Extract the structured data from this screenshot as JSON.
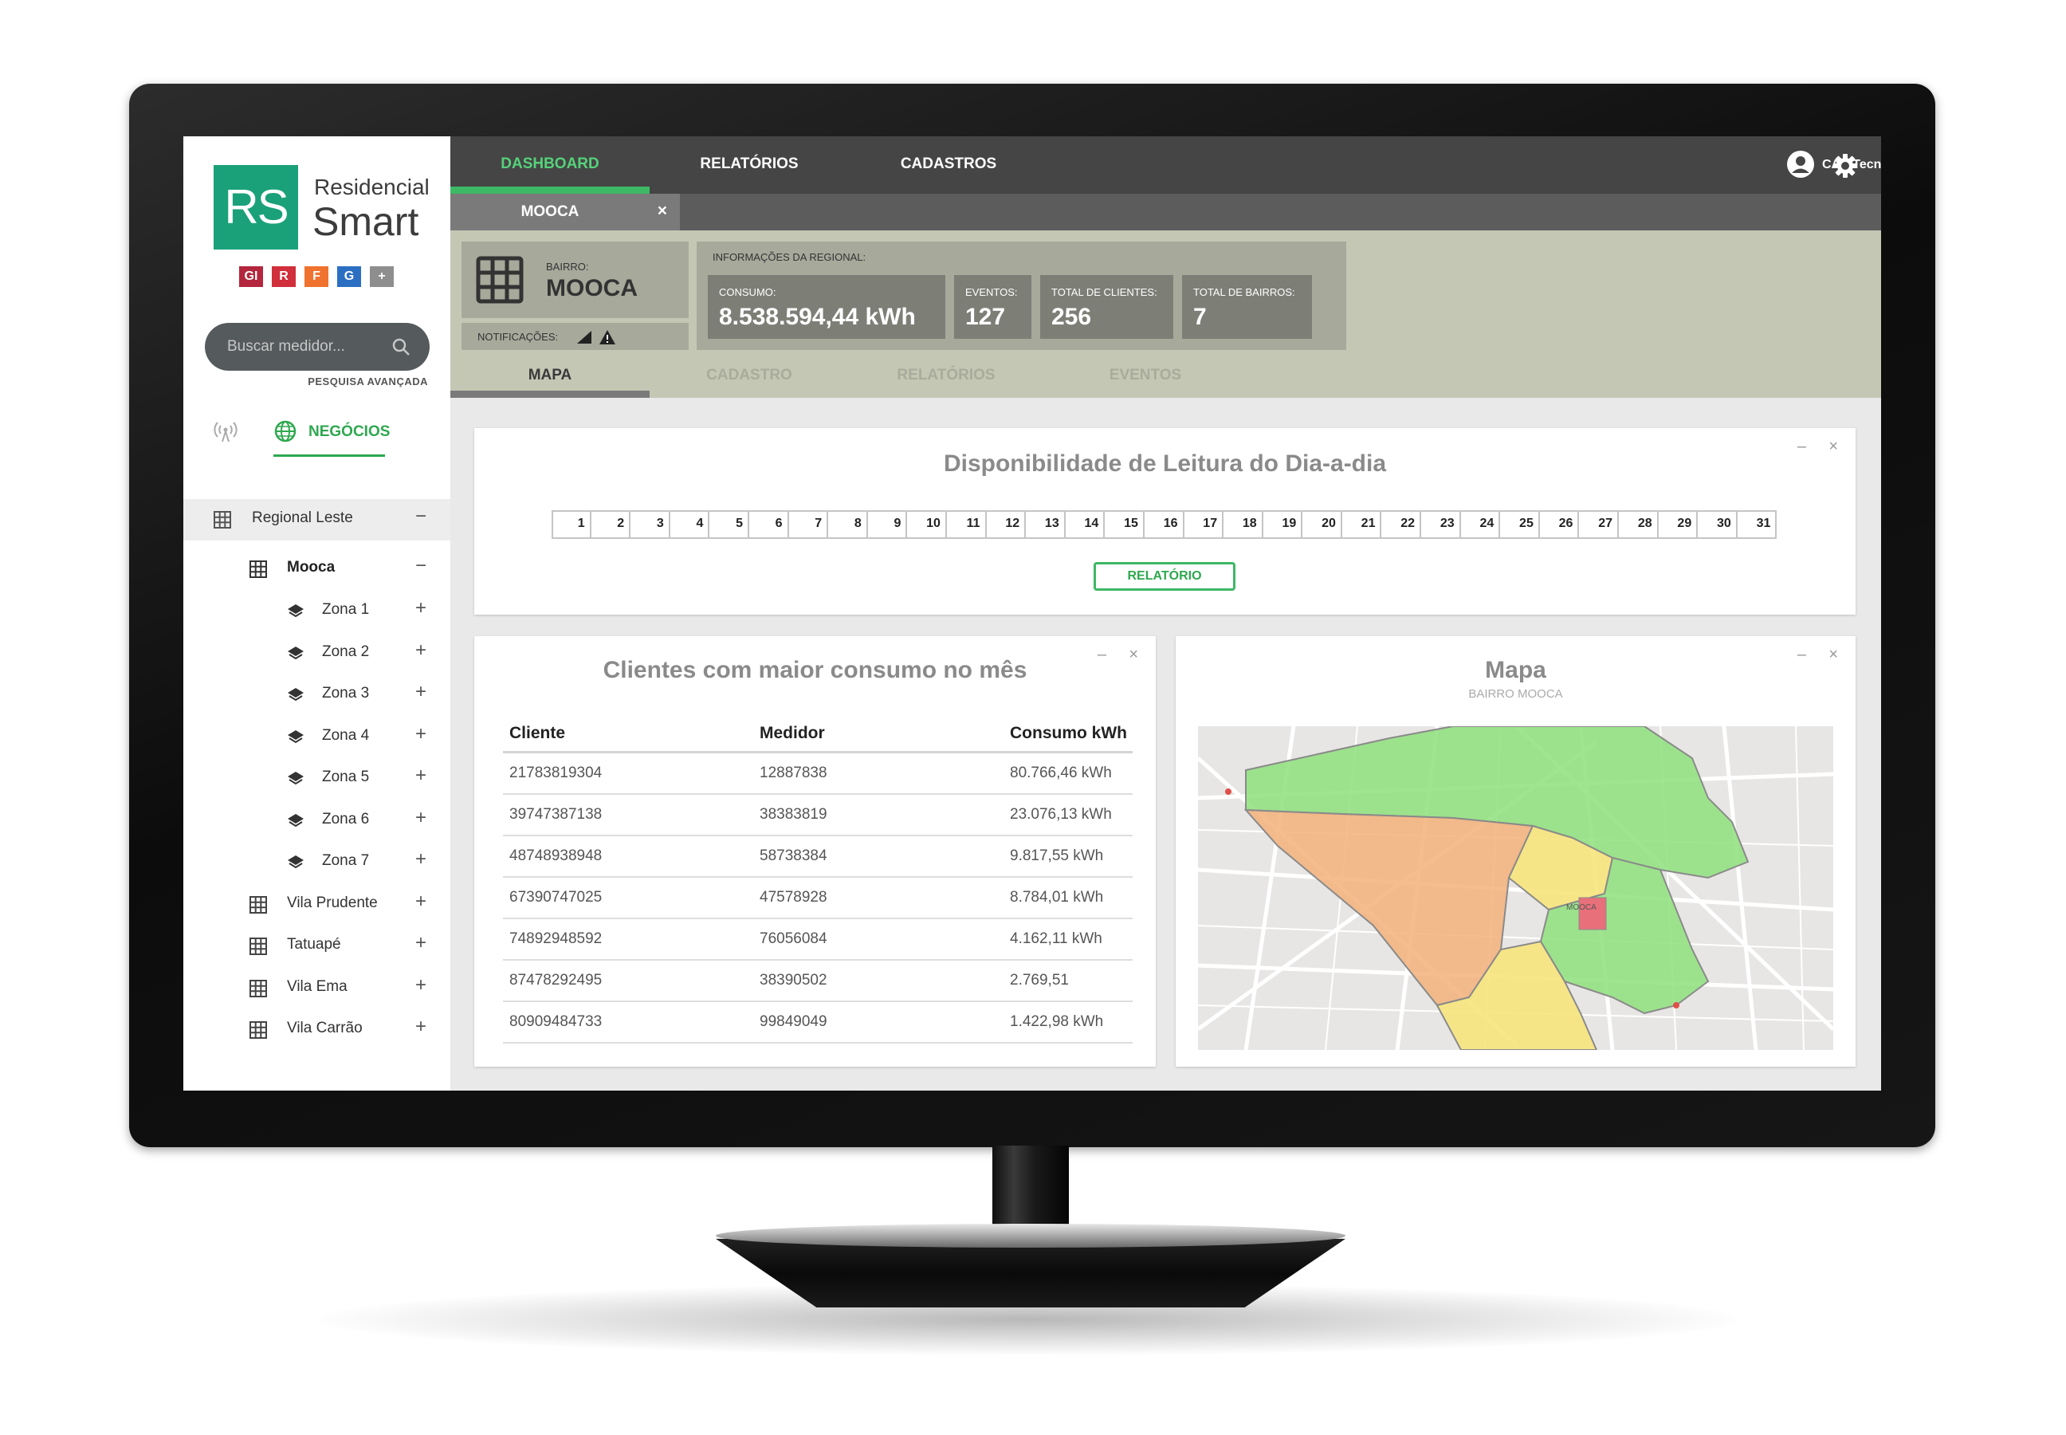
{
  "brand": {
    "logo_mark": "RS",
    "line1": "Residencial",
    "line2": "Smart"
  },
  "modules": [
    {
      "label": "GI",
      "color": "#b3263d"
    },
    {
      "label": "R",
      "color": "#d12f3b"
    },
    {
      "label": "F",
      "color": "#f0722f"
    },
    {
      "label": "G",
      "color": "#2b6fc2"
    },
    {
      "label": "+",
      "color": "#8e8e8e"
    }
  ],
  "search": {
    "placeholder": "Buscar medidor...",
    "advanced": "PESQUISA AVANÇADA"
  },
  "mode_tab": {
    "label": "NEGÓCIOS"
  },
  "tree": {
    "regional": {
      "label": "Regional Leste",
      "toggle": "−"
    },
    "bairro": {
      "label": "Mooca",
      "toggle": "−"
    },
    "zonas": [
      {
        "label": "Zona 1",
        "toggle": "+"
      },
      {
        "label": "Zona 2",
        "toggle": "+"
      },
      {
        "label": "Zona 3",
        "toggle": "+"
      },
      {
        "label": "Zona 4",
        "toggle": "+"
      },
      {
        "label": "Zona 5",
        "toggle": "+"
      },
      {
        "label": "Zona 6",
        "toggle": "+"
      },
      {
        "label": "Zona 7",
        "toggle": "+"
      }
    ],
    "others": [
      {
        "label": "Vila Prudente",
        "toggle": "+"
      },
      {
        "label": "Tatuapé",
        "toggle": "+"
      },
      {
        "label": "Vila Ema",
        "toggle": "+"
      },
      {
        "label": "Vila Carrão",
        "toggle": "+"
      }
    ]
  },
  "topnav": [
    {
      "label": "DASHBOARD",
      "active": true
    },
    {
      "label": "RELATÓRIOS",
      "active": false
    },
    {
      "label": "CADASTROS",
      "active": false
    }
  ],
  "user": {
    "name": "CAS Tecnologia"
  },
  "open_tab": {
    "label": "MOOCA",
    "close": "×"
  },
  "bairro": {
    "caption": "BAIRRO:",
    "value": "MOOCA"
  },
  "notifications": {
    "label": "NOTIFICAÇÕES:"
  },
  "regional_info": {
    "caption": "INFORMAÇÕES DA REGIONAL:",
    "cards": [
      {
        "key": "CONSUMO:",
        "value": "8.538.594,44 kWh"
      },
      {
        "key": "EVENTOS:",
        "value": "127"
      },
      {
        "key": "TOTAL DE CLIENTES:",
        "value": "256"
      },
      {
        "key": "TOTAL DE BAIRROS:",
        "value": "7"
      }
    ]
  },
  "subnav": [
    {
      "label": "MAPA",
      "active": true
    },
    {
      "label": "CADASTRO",
      "active": false
    },
    {
      "label": "RELATÓRIOS",
      "active": false
    },
    {
      "label": "EVENTOS",
      "active": false
    }
  ],
  "panel_controls": {
    "minimize": "–",
    "close": "×"
  },
  "availability": {
    "title": "Disponibilidade de Leitura do Dia-a-dia",
    "days": [
      "1",
      "2",
      "3",
      "4",
      "5",
      "6",
      "7",
      "8",
      "9",
      "10",
      "11",
      "12",
      "13",
      "14",
      "15",
      "16",
      "17",
      "18",
      "19",
      "20",
      "21",
      "22",
      "23",
      "24",
      "25",
      "26",
      "27",
      "28",
      "29",
      "30",
      "31"
    ],
    "button": "RELATÓRIO"
  },
  "top_clients": {
    "title": "Clientes com maior consumo no mês",
    "columns": [
      "Cliente",
      "Medidor",
      "Consumo kWh"
    ],
    "rows": [
      [
        "21783819304",
        "12887838",
        "80.766,46 kWh"
      ],
      [
        "39747387138",
        "38383819",
        "23.076,13 kWh"
      ],
      [
        "48748938948",
        "58738384",
        "9.817,55 kWh"
      ],
      [
        "67390747025",
        "47578928",
        "8.784,01 kWh"
      ],
      [
        "74892948592",
        "76056084",
        "4.162,11 kWh"
      ],
      [
        "87478292495",
        "38390502",
        "2.769,51"
      ],
      [
        "80909484733",
        "99849049",
        "1.422,98 kWh"
      ]
    ]
  },
  "map_panel": {
    "title": "Mapa",
    "subtitle": "BAIRRO MOOCA",
    "label_area": "MOOCA"
  },
  "colors": {
    "accent_green": "#3db865",
    "zone_green": "#8ee07d",
    "zone_orange": "#f3b07a",
    "zone_yellow": "#f6e47c",
    "zone_red": "#e8707a"
  }
}
